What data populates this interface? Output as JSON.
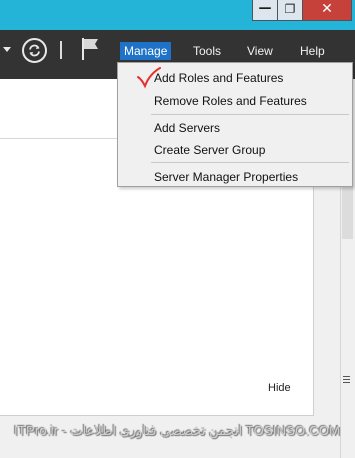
{
  "window": {
    "buttons": {
      "minimize": "—",
      "maximize": "❐",
      "close": "✕"
    },
    "colors": {
      "titlebar": "#24b4d8",
      "toolbar": "#333333",
      "close_button": "#c7413b",
      "menu_active": "#1e73c8"
    }
  },
  "toolbar": {
    "icons": [
      "dropdown-arrow-icon",
      "refresh-icon",
      "flag-icon"
    ]
  },
  "menubar": {
    "manage": "Manage",
    "tools": "Tools",
    "view": "View",
    "help": "Help"
  },
  "manage_menu": {
    "items": [
      "Add Roles and Features",
      "Remove Roles and Features",
      "Add Servers",
      "Create Server Group",
      "Server Manager Properties"
    ]
  },
  "panel": {
    "hide_label": "Hide"
  },
  "watermark": "ITPro.ir - انجمن تخصصی فناوری اطلاعات TOSINSO.COM"
}
